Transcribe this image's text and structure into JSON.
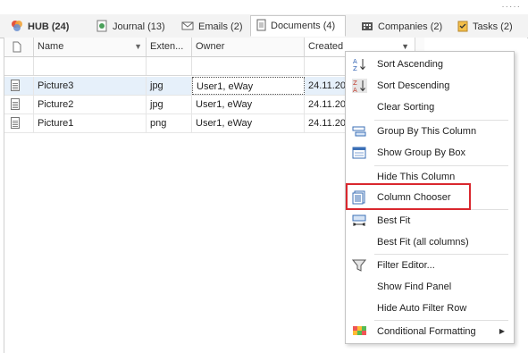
{
  "tabs": [
    {
      "label": "HUB (24)",
      "icon": "hub-icon"
    },
    {
      "label": "Journal (13)",
      "icon": "journal-icon"
    },
    {
      "label": "Emails (2)",
      "icon": "email-icon"
    },
    {
      "label": "Documents (4)",
      "icon": "document-icon"
    },
    {
      "label": "Companies (2)",
      "icon": "companies-icon"
    },
    {
      "label": "Tasks (2)",
      "icon": "tasks-icon"
    }
  ],
  "grid": {
    "columns": [
      "Name",
      "Exten...",
      "Owner",
      "Created"
    ],
    "rows": [
      {
        "name": "Picture3",
        "ext": "jpg",
        "owner": "User1, eWay",
        "created": "24.11.20"
      },
      {
        "name": "Picture2",
        "ext": "jpg",
        "owner": "User1, eWay",
        "created": "24.11.20"
      },
      {
        "name": "Picture1",
        "ext": "png",
        "owner": "User1, eWay",
        "created": "24.11.20"
      }
    ]
  },
  "menu": {
    "items": [
      {
        "label": "Sort Ascending",
        "icon": "sort-ascending-icon"
      },
      {
        "label": "Sort Descending",
        "icon": "sort-descending-icon"
      },
      {
        "label": "Clear Sorting",
        "icon": ""
      },
      {
        "label": "Group By This Column",
        "icon": "group-by-icon"
      },
      {
        "label": "Show Group By Box",
        "icon": "group-box-icon"
      },
      {
        "label": "Hide This Column",
        "icon": ""
      },
      {
        "label": "Column Chooser",
        "icon": "column-chooser-icon"
      },
      {
        "label": "Best Fit",
        "icon": "best-fit-icon"
      },
      {
        "label": "Best Fit (all columns)",
        "icon": ""
      },
      {
        "label": "Filter Editor...",
        "icon": "filter-icon"
      },
      {
        "label": "Show Find Panel",
        "icon": ""
      },
      {
        "label": "Hide Auto Filter Row",
        "icon": ""
      },
      {
        "label": "Conditional Formatting",
        "icon": "conditional-formatting-icon"
      }
    ]
  },
  "colors": {
    "highlight": "#d9272e",
    "focused_row": "#e6f0fa"
  }
}
